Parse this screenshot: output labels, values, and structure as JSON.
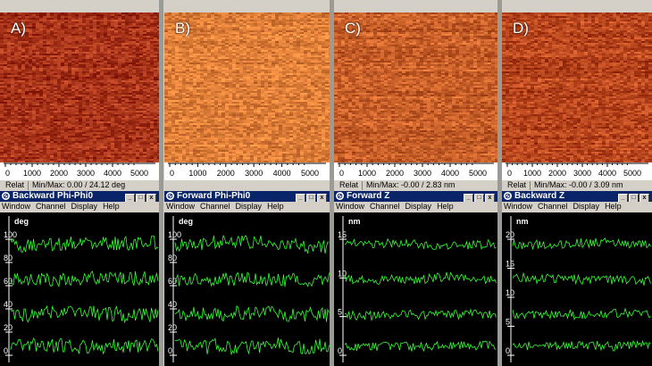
{
  "panels": [
    {
      "label": "A)",
      "x_ticks": [
        "0",
        "1000",
        "2000",
        "3000",
        "4000",
        "5000"
      ],
      "status_left": "Relat",
      "status_minmax": "Min/Max: 0.00 / 24.12 deg",
      "window_title": "Backward Phi-Phi0",
      "unit": "deg",
      "y_ticks": [
        "100",
        "80",
        "60",
        "40",
        "20",
        "0"
      ],
      "image_base_color": "#a8341a"
    },
    {
      "label": "B)",
      "x_ticks": [
        "0",
        "1000",
        "2000",
        "3000",
        "4000",
        "5000"
      ],
      "status_left": "",
      "status_minmax": "",
      "window_title": "Forward Phi-Phi0",
      "unit": "deg",
      "y_ticks": [
        "100",
        "80",
        "60",
        "40",
        "20",
        "0"
      ],
      "image_base_color": "#e0803a"
    },
    {
      "label": "C)",
      "x_ticks": [
        "0",
        "1000",
        "2000",
        "3000",
        "4000",
        "5000"
      ],
      "status_left": "Relat",
      "status_minmax": "Min/Max: -0.00 / 2.83 nm",
      "window_title": "Forward Z",
      "unit": "nm",
      "y_ticks": [
        "15",
        "10",
        "5",
        "0"
      ],
      "image_base_color": "#c8602a"
    },
    {
      "label": "D)",
      "x_ticks": [
        "0",
        "1000",
        "2000",
        "3000",
        "4000",
        "5000"
      ],
      "status_left": "Relat",
      "status_minmax": "Min/Max: -0.00 / 3.09 nm",
      "window_title": "Backward Z",
      "unit": "nm",
      "y_ticks": [
        "20",
        "15",
        "10",
        "5",
        "0"
      ],
      "image_base_color": "#b8461e"
    }
  ],
  "menu_items": [
    "Window",
    "Channel",
    "Display",
    "Help"
  ],
  "window_buttons": [
    "_",
    "□",
    "x"
  ],
  "window_icon": "app-icon",
  "trace_color": "#33ff33"
}
